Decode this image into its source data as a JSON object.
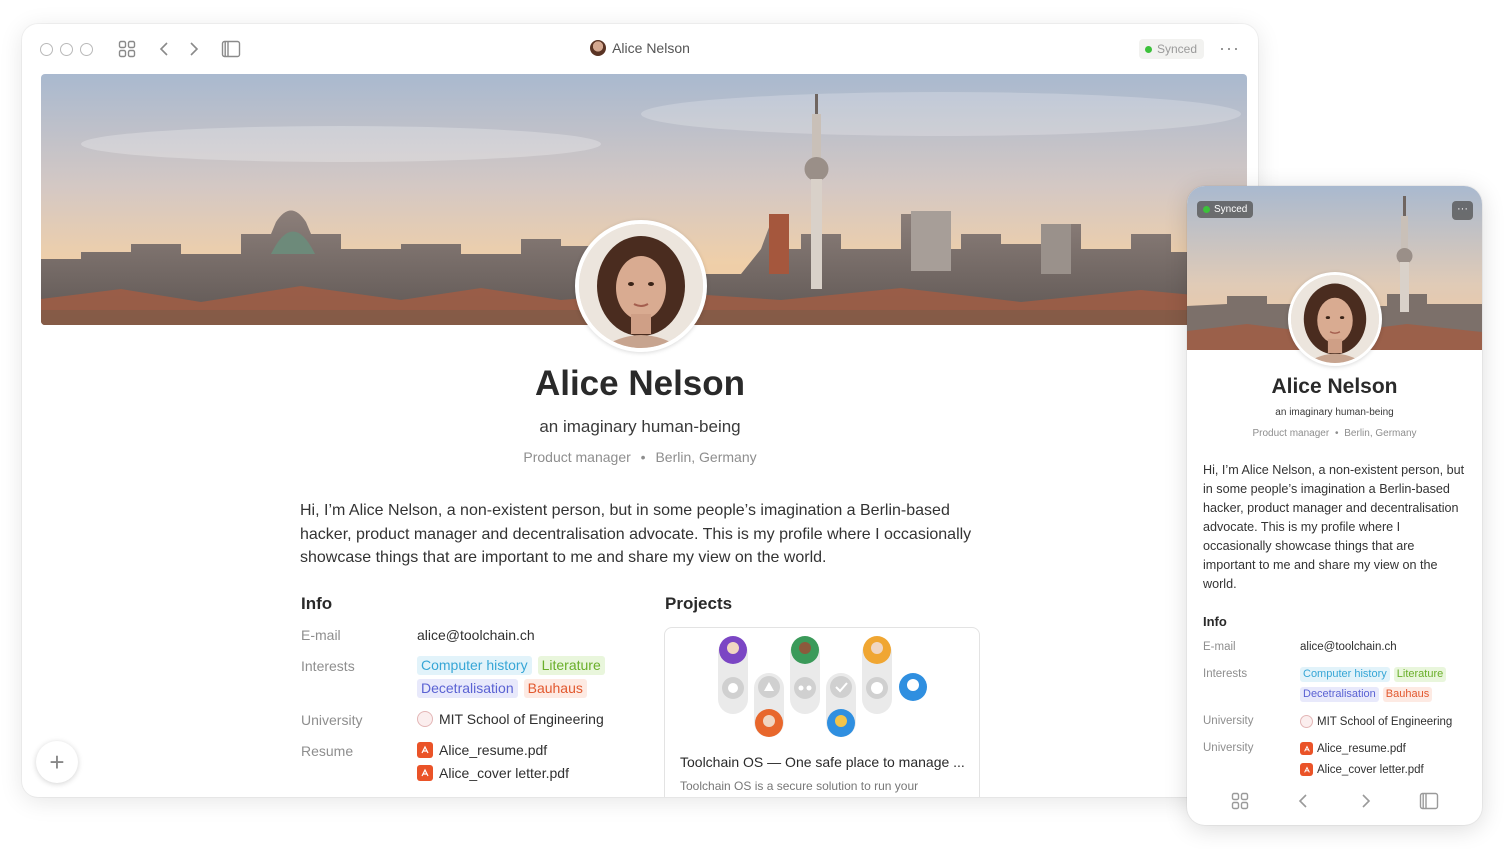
{
  "window": {
    "title": "Alice Nelson",
    "sync_status": "Synced",
    "more_label": "···"
  },
  "profile": {
    "name": "Alice Nelson",
    "tagline": "an imaginary human-being",
    "role": "Product manager",
    "separator": "•",
    "location": "Berlin, Germany",
    "bio": "Hi, I’m Alice Nelson, a non-existent person, but in some people’s imagination a Berlin-based hacker, product manager and decentralisation advocate. This is my profile where I occasionally showcase things that are important to me and share my view on the world."
  },
  "info": {
    "heading": "Info",
    "email_label": "E-mail",
    "email": "alice@toolchain.ch",
    "interests_label": "Interests",
    "interests": [
      "Computer history",
      "Literature",
      "Decetralisation",
      "Bauhaus"
    ],
    "university_label": "University",
    "university": "MIT School of Engineering",
    "resume_label": "Resume",
    "files": [
      "Alice_resume.pdf",
      "Alice_cover letter.pdf"
    ]
  },
  "projects": {
    "heading": "Projects",
    "card_title": "Toolchain OS — One safe place to manage ...",
    "card_desc": "Toolchain OS is a secure solution to run your"
  },
  "mobile": {
    "sync_status": "Synced",
    "more_label": "···",
    "resume_label": "University"
  },
  "fab_label": "+",
  "colors": {
    "synced_dot": "#3cc13b",
    "tag_blue": "#37a6d6",
    "tag_green": "#6aaf2a",
    "tag_purple": "#5a62d3",
    "tag_red": "#e2582e",
    "pdf": "#ea5328"
  }
}
